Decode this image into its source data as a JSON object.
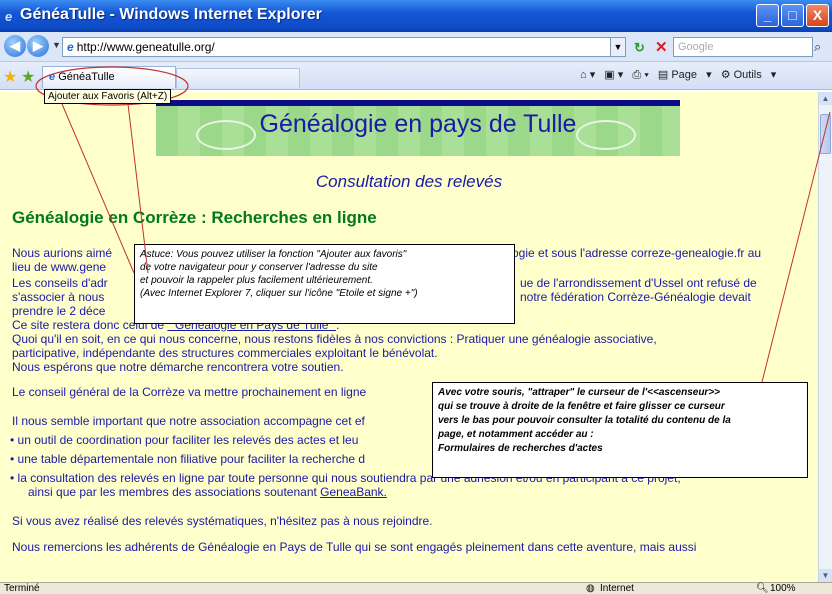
{
  "window": {
    "title": "GénéaTulle - Windows Internet Explorer",
    "minimize": "_",
    "maximize": "□",
    "close": "X"
  },
  "address_bar": {
    "url": "http://www.geneatulle.org/",
    "search_placeholder": "Google"
  },
  "tab": {
    "label": "GénéaTulle",
    "tooltip": "Ajouter aux Favoris (Alt+Z)"
  },
  "toolbar": {
    "page_label": "Page",
    "tools_label": "Outils"
  },
  "page": {
    "banner_title": "Généalogie en pays de Tulle",
    "subtitle": "Consultation des relevés",
    "heading": "Généalogie en Corrèze : Recherches en ligne",
    "p1_a": "Nous aurions aimé",
    "p1_b": "ogie et sous l'adresse correze-genealogie.fr au",
    "p2": "lieu de www.gene",
    "p3_a": "Les conseils d'adr",
    "p3_b": "ue de l'arrondissement d'Ussel ont refusé de",
    "p4_a": "s'associer à nous",
    "p4_b": "notre fédération Corrèze-Généalogie devait",
    "p5": "prendre le 2 déce",
    "p6_prefix": "Ce site restera donc celui de ",
    "p6_link": "\" Généalogie en Pays de Tulle \"",
    "p6_suffix": ".",
    "p7": "Quoi qu'il en soit, en ce qui nous concerne, nous restons fidèles à nos convictions : Pratiquer une généalogie associative,",
    "p8": "participative, indépendante des structures commerciales exploitant le bénévolat.",
    "p9": "Nous espérons que notre démarche rencontrera votre soutien.",
    "p10": "Le conseil général de la Corrèze va mettre prochainement en ligne",
    "p11": "Il nous semble important que notre association accompagne cet ef",
    "b1": "• un outil de coordination pour  faciliter les relevés des actes et leu",
    "b2": "• une table départementale non filiative pour faciliter la recherche d",
    "b3": "• la consultation des relevés en ligne par toute personne qui nous soutiendra par une adhésion et/ou en participant à ce projet,",
    "b3_cont_prefix": "ainsi que par les membres des associations soutenant ",
    "b3_link": "GeneaBank.",
    "p12": "Si vous avez réalisé des relevés systématiques, n'hésitez pas à nous rejoindre.",
    "p13": "Nous remercions les adhérents de Généalogie en Pays de Tulle qui se sont engagés pleinement dans cette aventure, mais aussi"
  },
  "callout1": {
    "l1": "Astuce: Vous pouvez utiliser la fonction \"Ajouter aux favoris\"",
    "l2": " de votre navigateur pour y conserver l'adresse du site",
    "l3": " et pouvoir la rappeler plus facilement ultérieurement.",
    "l4": "(Avec Internet Explorer 7, cliquer sur l'icône \"Etoile et signe +\")"
  },
  "callout2": {
    "l1": "Avec votre souris, \"attraper\" le curseur de l'<<ascenseur>>",
    "l2": " qui se trouve à droite de la fenêtre et faire glisser ce curseur",
    "l3": " vers le bas pour pouvoir  consulter la totalité du contenu de la",
    "l4": "page, et notamment accéder au :",
    "l5": "  Formulaires de recherches d'actes"
  },
  "status": {
    "left": "Terminé",
    "zone": "Internet",
    "zoom": "100%"
  }
}
